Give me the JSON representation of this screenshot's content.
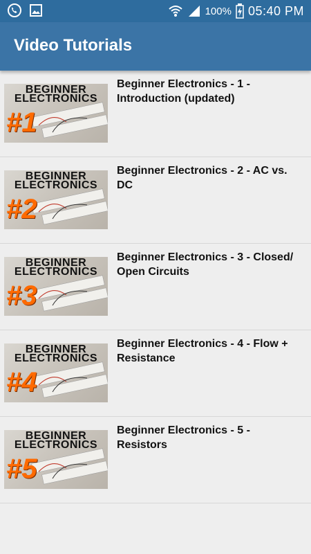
{
  "status_bar": {
    "battery": "100%",
    "time": "05:40 PM",
    "icons": [
      "viber-icon",
      "image-icon",
      "wifi-icon",
      "signal-icon",
      "battery-charging-icon"
    ]
  },
  "app_bar": {
    "title": "Video Tutorials"
  },
  "videos": [
    {
      "title": "Beginner Electronics - 1 - Introduction (updated)",
      "thumb_line1": "BEGINNER",
      "thumb_line2": "ELECTRONICS",
      "thumb_num": "#1"
    },
    {
      "title": "Beginner Electronics - 2 - AC vs. DC",
      "thumb_line1": "BEGINNER",
      "thumb_line2": "ELECTRONICS",
      "thumb_num": "#2"
    },
    {
      "title": "Beginner Electronics - 3 - Closed/ Open Circuits",
      "thumb_line1": "BEGINNER",
      "thumb_line2": "ELECTRONICS",
      "thumb_num": "#3"
    },
    {
      "title": "Beginner Electronics - 4 - Flow + Resistance",
      "thumb_line1": "BEGINNER",
      "thumb_line2": "ELECTRONICS",
      "thumb_num": "#4"
    },
    {
      "title": "Beginner Electronics - 5 - Resistors",
      "thumb_line1": "BEGINNER",
      "thumb_line2": "ELECTRONICS",
      "thumb_num": "#5"
    }
  ],
  "colors": {
    "status_bar": "#2e6c9e",
    "app_bar": "#3b74a6",
    "background": "#eeeeee",
    "thumb_number": "#ff6a00"
  }
}
